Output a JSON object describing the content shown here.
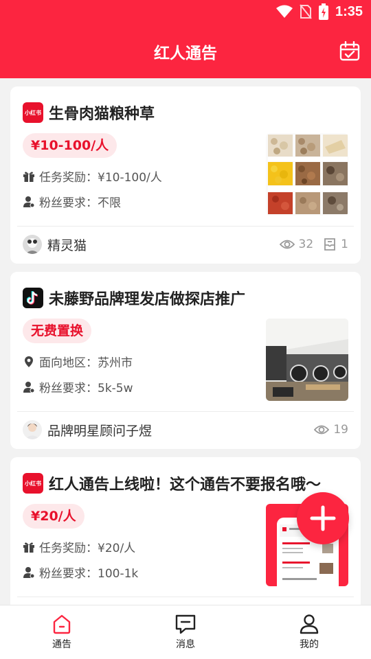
{
  "status_bar": {
    "time": "1:35"
  },
  "header": {
    "title": "红人通告"
  },
  "cards": [
    {
      "platform": "小红书",
      "title": "生骨肉猫粮种草",
      "tag": "¥10-100/人",
      "lines": [
        {
          "icon": "gift-icon",
          "text": "任务奖励：¥10-100/人"
        },
        {
          "icon": "user-icon",
          "text": "粉丝要求：不限"
        }
      ],
      "author": "精灵猫",
      "views": "32",
      "applies": "1"
    },
    {
      "platform": "抖音",
      "title": "未藤野品牌理发店做探店推广",
      "tag": "无费置换",
      "lines": [
        {
          "icon": "location-icon",
          "text": "面向地区：苏州市"
        },
        {
          "icon": "user-icon",
          "text": "粉丝要求：5k-5w"
        }
      ],
      "author": "品牌明星顾问子煜",
      "views": "19"
    },
    {
      "platform": "小红书",
      "title": "红人通告上线啦！这个通告不要报名哦～",
      "tag": "¥20/人",
      "lines": [
        {
          "icon": "gift-icon",
          "text": "任务奖励：¥20/人"
        },
        {
          "icon": "user-icon",
          "text": "粉丝要求：100-1k"
        }
      ]
    }
  ],
  "tabs": [
    {
      "label": "通告",
      "icon": "home-icon",
      "active": true
    },
    {
      "label": "消息",
      "icon": "message-icon",
      "active": false
    },
    {
      "label": "我的",
      "icon": "profile-icon",
      "active": false
    }
  ],
  "colors": {
    "brand": "#fc2540",
    "tag_bg": "#fde8ea",
    "tag_text": "#e8112c"
  }
}
